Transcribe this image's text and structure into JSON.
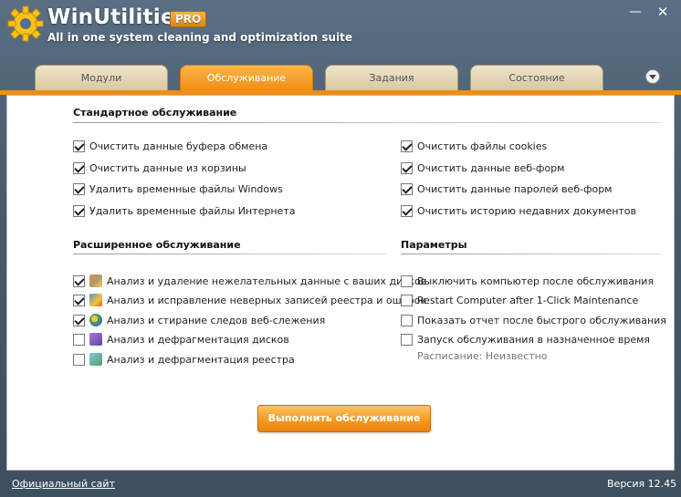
{
  "header": {
    "title": "WinUtilities",
    "badge": "PRO",
    "subtitle": "All in one system cleaning and optimization suite",
    "minimize": "—",
    "close": "✕"
  },
  "tabs": [
    {
      "label": "Модули",
      "active": false
    },
    {
      "label": "Обслуживание",
      "active": true
    },
    {
      "label": "Задания",
      "active": false
    },
    {
      "label": "Состояние",
      "active": false
    }
  ],
  "standard": {
    "title": "Стандартное обслуживание",
    "left": [
      {
        "label": "Очистить данные буфера обмена",
        "checked": true
      },
      {
        "label": "Очистить данные из корзины",
        "checked": true
      },
      {
        "label": "Удалить временные файлы Windows",
        "checked": true
      },
      {
        "label": "Удалить временные файлы Интернета",
        "checked": true
      }
    ],
    "right": [
      {
        "label": "Очистить файлы cookies",
        "checked": true
      },
      {
        "label": "Очистить данные веб-форм",
        "checked": true
      },
      {
        "label": "Очистить данные паролей веб-форм",
        "checked": true
      },
      {
        "label": "Очистить историю недавних документов",
        "checked": true
      }
    ]
  },
  "advanced": {
    "title": "Расширенное обслуживание",
    "items": [
      {
        "label": "Анализ и удаление нежелательных данные с ваших дисков",
        "checked": true,
        "icon": "disk-cleaner-icon"
      },
      {
        "label": "Анализ и исправление неверных записей реестра и ошибок",
        "checked": true,
        "icon": "registry-icon"
      },
      {
        "label": "Анализ и стирание следов веб-слежения",
        "checked": true,
        "icon": "web-tracks-icon"
      },
      {
        "label": "Анализ и дефрагментация дисков",
        "checked": false,
        "icon": "disk-defrag-icon"
      },
      {
        "label": "Анализ и дефрагментация реестра",
        "checked": false,
        "icon": "registry-defrag-icon"
      }
    ]
  },
  "params": {
    "title": "Параметры",
    "items": [
      {
        "label": "Выключить компьютер после обслуживания",
        "checked": false
      },
      {
        "label": "Restart Computer after 1-Click Maintenance",
        "checked": false
      },
      {
        "label": "Показать отчет после быстрого обслуживания",
        "checked": false
      },
      {
        "label": "Запуск обслуживания в назначенное время",
        "checked": false
      }
    ],
    "schedule": "Расписание: Неизвестно"
  },
  "run_button": "Выполнить обслуживание",
  "footer": {
    "site_link": "Официальный сайт",
    "version": "Версия 12.45"
  },
  "colors": {
    "accent": "#f18d12",
    "background": "#485a6c",
    "tab_inactive": "#e3d4b3"
  }
}
